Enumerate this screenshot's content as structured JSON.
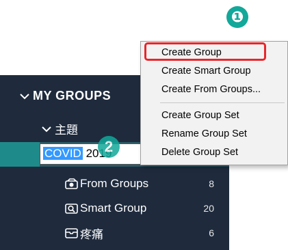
{
  "colors": {
    "sidebar_bg": "#1f2b3d",
    "selection": "#2b5b65",
    "badge": "#12a89a",
    "highlight_border": "#e8262b"
  },
  "sidebar": {
    "section_title": "MY GROUPS",
    "section_icon": "chevron-down-icon",
    "folder_label": "主題",
    "rename_value_highlighted": "COVID",
    "rename_value_rest": "2019",
    "groups": [
      {
        "icon": "from-groups-icon",
        "label": "From Groups",
        "count": "8"
      },
      {
        "icon": "smart-group-icon",
        "label": "Smart Group",
        "count": "20"
      },
      {
        "icon": "group-icon",
        "label": "疼痛",
        "count": "6"
      }
    ]
  },
  "context_menu": {
    "items": [
      "Create Group",
      "Create Smart Group",
      "Create From Groups...",
      "Create Group Set",
      "Rename Group Set",
      "Delete Group Set"
    ]
  },
  "annotations": {
    "badge_1": "❶",
    "badge_2": "2"
  }
}
